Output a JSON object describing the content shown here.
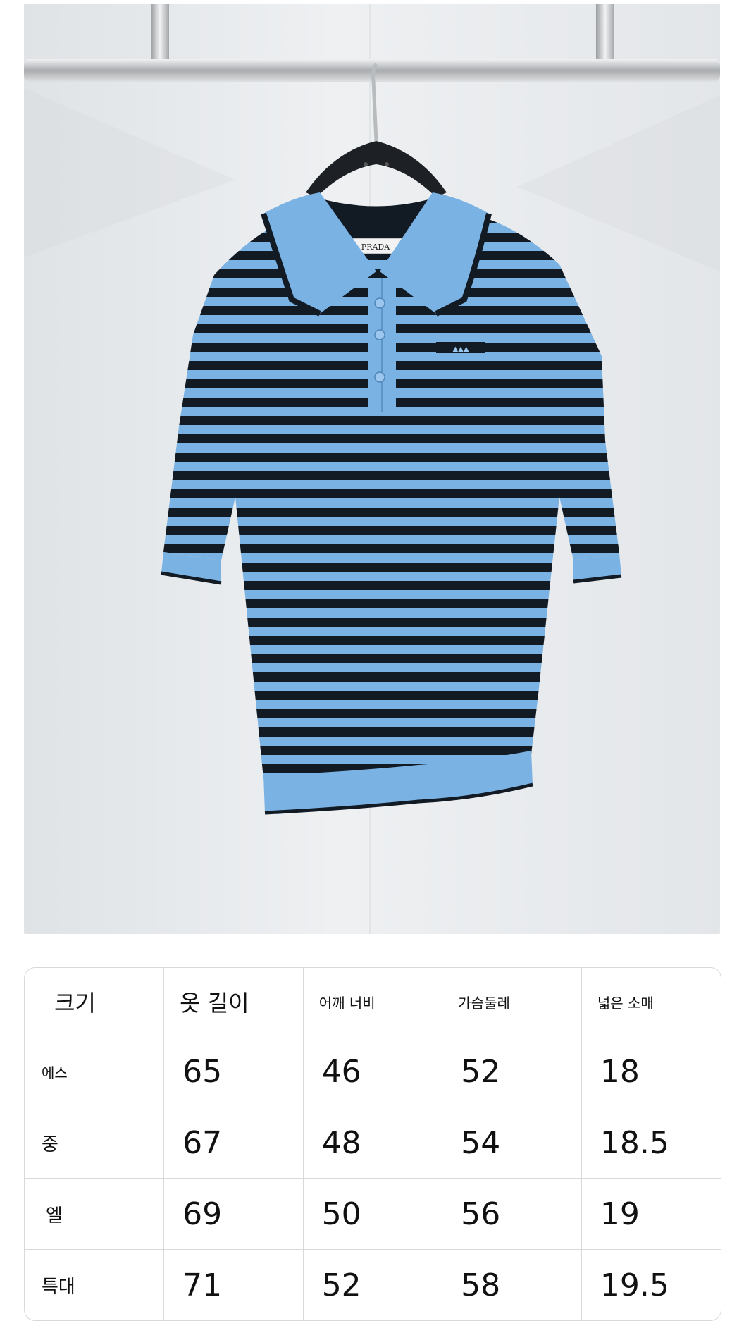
{
  "product_photo": {
    "label_text": "PRADA",
    "colors": {
      "wall": "#e8ebed",
      "stripe_light": "#7ab2e4",
      "stripe_dark": "#121a24",
      "hanger": "#1d2024",
      "rail": "#c7c9cb"
    }
  },
  "size_table": {
    "headers": [
      "크기",
      "옷 길이",
      "어깨 너비",
      "가슴둘레",
      "넓은 소매"
    ],
    "rows": [
      {
        "size": "에스",
        "length": "65",
        "shoulder": "46",
        "chest": "52",
        "sleeve": "18"
      },
      {
        "size": "중",
        "length": "67",
        "shoulder": "48",
        "chest": "54",
        "sleeve": "18.5"
      },
      {
        "size": "엘",
        "length": "69",
        "shoulder": "50",
        "chest": "56",
        "sleeve": "19"
      },
      {
        "size": "특대",
        "length": "71",
        "shoulder": "52",
        "chest": "58",
        "sleeve": "19.5"
      }
    ]
  }
}
